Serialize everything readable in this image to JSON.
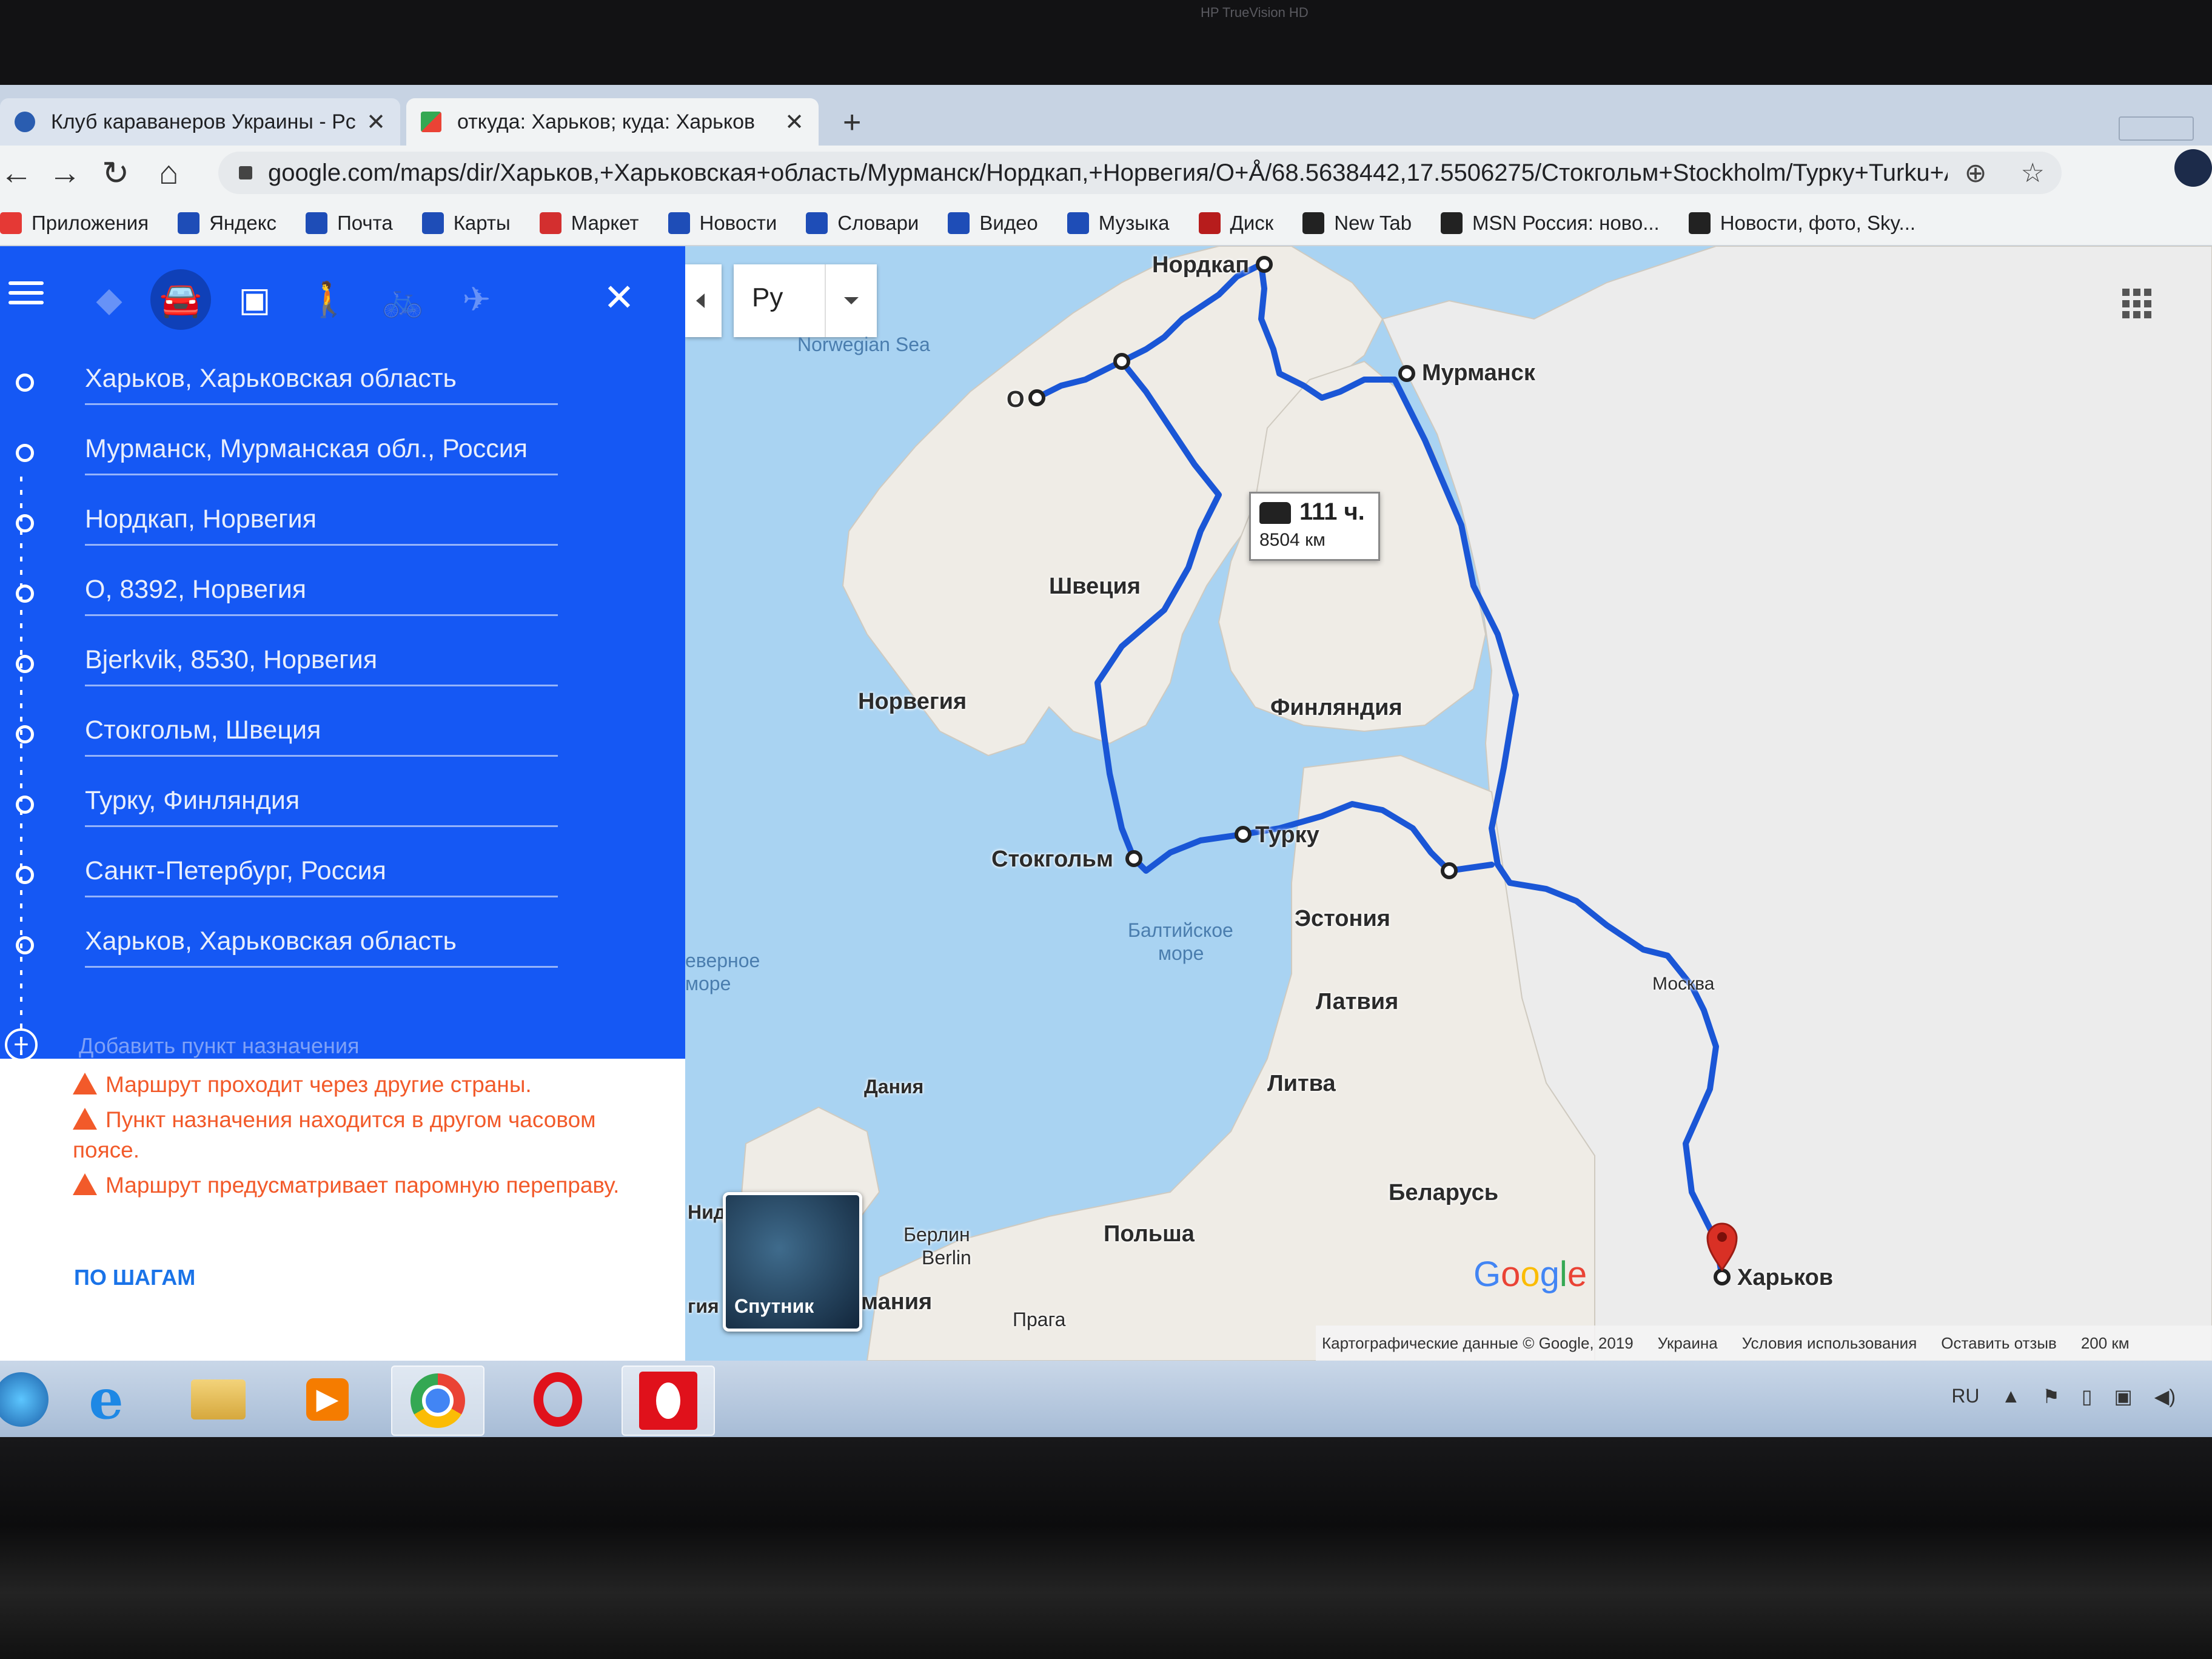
{
  "camera_label": "HP TrueVision HD",
  "browser": {
    "tabs": [
      {
        "title": "Клуб караванеров Украины - Рс",
        "active": false,
        "favicon_color": "#2a5db0"
      },
      {
        "title": "откуда: Харьков; куда: Харьков",
        "active": true,
        "favicon_color": "#34a853"
      }
    ],
    "new_tab_symbol": "+",
    "url": "google.com/maps/dir/Харьков,+Харьковская+область/Мурманск/Нордкап,+Норвегия/O+Å/68.5638442,17.5506275/Стокгольм+Stockholm/Турку+Turku+Åbo/Ca...",
    "bookmarks": [
      {
        "label": "Приложения",
        "icon": "apps-grid-icon",
        "color": "#e53935"
      },
      {
        "label": "Яндекс",
        "icon": "star-icon",
        "color": "#1e4db7"
      },
      {
        "label": "Почта",
        "icon": "mail-icon",
        "color": "#1e4db7"
      },
      {
        "label": "Карты",
        "icon": "maps-icon",
        "color": "#1e4db7"
      },
      {
        "label": "Маркет",
        "icon": "market-icon",
        "color": "#d32f2f"
      },
      {
        "label": "Новости",
        "icon": "news-icon",
        "color": "#1e4db7"
      },
      {
        "label": "Словари",
        "icon": "dictionary-icon",
        "color": "#1e4db7"
      },
      {
        "label": "Видео",
        "icon": "star-icon",
        "color": "#1e4db7"
      },
      {
        "label": "Музыка",
        "icon": "star-icon",
        "color": "#1e4db7"
      },
      {
        "label": "Диск",
        "icon": "disk-icon",
        "color": "#b71c1c"
      },
      {
        "label": "New Tab",
        "icon": "globe-icon",
        "color": "#222222"
      },
      {
        "label": "MSN Россия: ново...",
        "icon": "msn-icon",
        "color": "#222222"
      },
      {
        "label": "Новости, фото, Sky...",
        "icon": "msn-icon",
        "color": "#222222"
      }
    ]
  },
  "sidebar": {
    "waypoints": [
      "Харьков, Харьковская область",
      "Мурманск, Мурманская обл., Россия",
      "Нордкап, Норвегия",
      "O, 8392, Норвегия",
      "Bjerkvik, 8530, Норвегия",
      "Стокгольм, Швеция",
      "Турку, Финляндия",
      "Санкт-Петербург, Россия",
      "Харьков, Харьковская область"
    ],
    "add_destination": "Добавить пункт назначения",
    "warnings": [
      "Маршрут проходит через другие страны.",
      "Пункт назначения находится в другом часовом поясе.",
      "Маршрут предусматривает паромную переправу."
    ],
    "steps_link": "ПО ШАГАМ"
  },
  "map": {
    "language_button": "Ру",
    "route_summary": {
      "duration": "111 ч.",
      "distance": "8504 км"
    },
    "labels": {
      "nordkap": "Нордкап",
      "murmansk": "Мурманск",
      "o_point": "O",
      "sweden": "Швеция",
      "norway": "Норвегия",
      "finland": "Финляндия",
      "turku": "Турку",
      "stockholm": "Стокгольм",
      "estonia": "Эстония",
      "latvia": "Латвия",
      "lithuania": "Литва",
      "belarus": "Беларусь",
      "poland": "Польша",
      "denmark": "Дания",
      "moscow": "Москва",
      "kharkiv": "Харьков",
      "berlin_ru": "Берлин",
      "berlin": "Berlin",
      "prague": "Прага",
      "germany_partial": "мания",
      "nid_partial": "Нид",
      "gia_partial": "гия"
    },
    "water_labels": {
      "norwegian_sea": "Norwegian Sea",
      "baltic_sea_1": "Балтийское",
      "baltic_sea_2": "море",
      "north_sea_1": "еверное",
      "north_sea_2": "море"
    },
    "satellite_label": "Спутник",
    "google_logo": "Google",
    "footer": [
      "Картографические данные © Google, 2019",
      "Украина",
      "Условия использования",
      "Оставить отзыв",
      "200 км"
    ],
    "colors": {
      "route": "#1a56d6",
      "land": "#efece6",
      "russia_land": "#ececec",
      "water": "#a9d3f2",
      "pin": "#d93025"
    }
  },
  "taskbar": {
    "apps": [
      "start-orb",
      "internet-explorer",
      "file-explorer",
      "media-player",
      "chrome",
      "opera",
      "opera-red"
    ],
    "tray_lang": "RU"
  }
}
